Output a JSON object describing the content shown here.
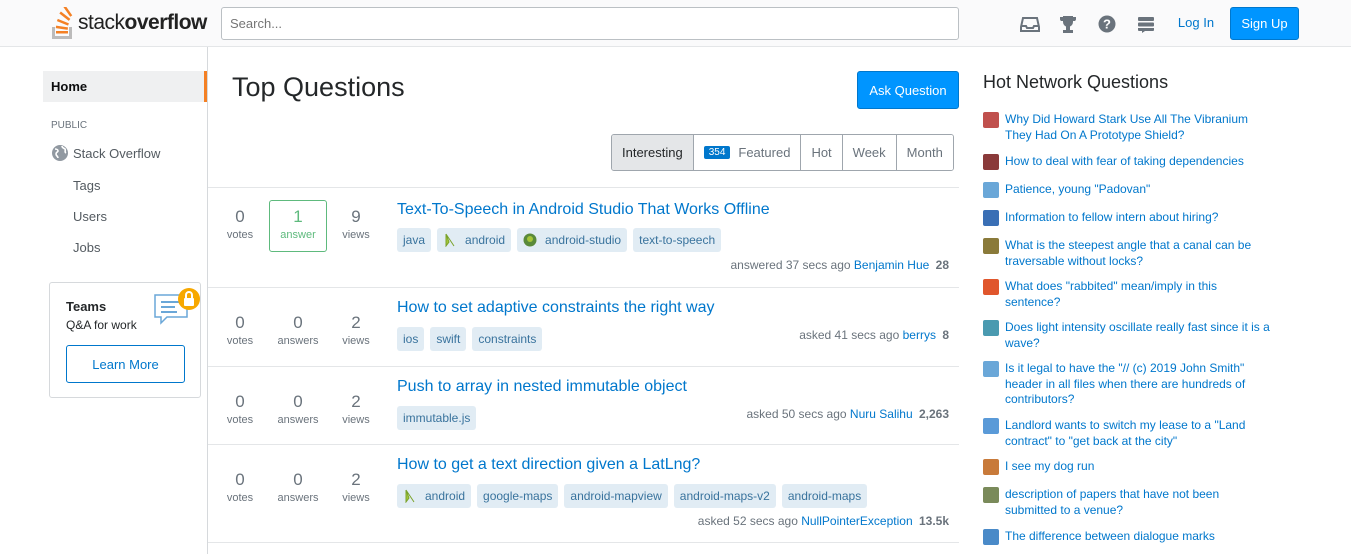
{
  "header": {
    "logo_plain": "stack",
    "logo_bold": "overflow",
    "search_placeholder": "Search...",
    "login": "Log In",
    "signup": "Sign Up",
    "icons": [
      "inbox-icon",
      "trophy-icon",
      "help-icon",
      "site-switcher-icon"
    ]
  },
  "leftnav": {
    "home": "Home",
    "public": "PUBLIC",
    "stack_overflow": "Stack Overflow",
    "tags": "Tags",
    "users": "Users",
    "jobs": "Jobs",
    "teams_title": "Teams",
    "teams_sub": "Q&A for work",
    "learn_more": "Learn More"
  },
  "main": {
    "title": "Top Questions",
    "ask": "Ask Question",
    "tabs": [
      {
        "label": "Interesting",
        "active": true
      },
      {
        "label": "Featured",
        "badge": "354"
      },
      {
        "label": "Hot"
      },
      {
        "label": "Week"
      },
      {
        "label": "Month"
      }
    ],
    "questions": [
      {
        "votes": "0",
        "votes_label": "votes",
        "answers": "1",
        "answers_label": "answer",
        "answered": true,
        "views": "9",
        "views_label": "views",
        "title": "Text-To-Speech in Android Studio That Works Offline",
        "tags": [
          {
            "t": "java"
          },
          {
            "t": "android",
            "icon": "android"
          },
          {
            "t": "android-studio",
            "icon": "studio"
          },
          {
            "t": "text-to-speech"
          }
        ],
        "action": "answered 37 secs ago",
        "user": "Benjamin Hue",
        "rep": "28"
      },
      {
        "votes": "0",
        "votes_label": "votes",
        "answers": "0",
        "answers_label": "answers",
        "views": "2",
        "views_label": "views",
        "title": "How to set adaptive constraints the right way",
        "tags": [
          {
            "t": "ios"
          },
          {
            "t": "swift"
          },
          {
            "t": "constraints"
          }
        ],
        "action": "asked 41 secs ago",
        "user": "berrys",
        "rep": "8"
      },
      {
        "votes": "0",
        "votes_label": "votes",
        "answers": "0",
        "answers_label": "answers",
        "views": "2",
        "views_label": "views",
        "title": "Push to array in nested immutable object",
        "tags": [
          {
            "t": "immutable.js"
          }
        ],
        "action": "asked 50 secs ago",
        "user": "Nuru Salihu",
        "rep": "2,263"
      },
      {
        "votes": "0",
        "votes_label": "votes",
        "answers": "0",
        "answers_label": "answers",
        "views": "2",
        "views_label": "views",
        "title": "How to get a text direction given a LatLng?",
        "tags": [
          {
            "t": "android",
            "icon": "android"
          },
          {
            "t": "google-maps"
          },
          {
            "t": "android-mapview"
          },
          {
            "t": "android-maps-v2"
          },
          {
            "t": "android-maps"
          }
        ],
        "action": "asked 52 secs ago",
        "user": "NullPointerException",
        "rep": "13.5k"
      }
    ]
  },
  "hot": {
    "title": "Hot Network Questions",
    "items": [
      {
        "text": "Why Did Howard Stark Use All The Vibranium They Had On A Prototype Shield?",
        "color": "#c0504d"
      },
      {
        "text": "How to deal with fear of taking dependencies",
        "color": "#8a3a3a"
      },
      {
        "text": "Patience, young \"Padovan\"",
        "color": "#6aa7d8"
      },
      {
        "text": "Information to fellow intern about hiring?",
        "color": "#3a6fb5"
      },
      {
        "text": "What is the steepest angle that a canal can be traversable without locks?",
        "color": "#8a7a3a"
      },
      {
        "text": "What does \"rabbited\" mean/imply in this sentence?",
        "color": "#e0562c"
      },
      {
        "text": "Does light intensity oscillate really fast since it is a wave?",
        "color": "#4a9ab0"
      },
      {
        "text": "Is it legal to have the \"// (c) 2019 John Smith\" header in all files when there are hundreds of contributors?",
        "color": "#6aa7d8"
      },
      {
        "text": "Landlord wants to switch my lease to a \"Land contract\" to \"get back at the city\"",
        "color": "#5a9ad8"
      },
      {
        "text": "I see my dog run",
        "color": "#c87a3a"
      },
      {
        "text": "description of papers that have not been submitted to a venue?",
        "color": "#7a8a5a"
      },
      {
        "text": "The difference between dialogue marks",
        "color": "#4a8ac8"
      }
    ]
  }
}
